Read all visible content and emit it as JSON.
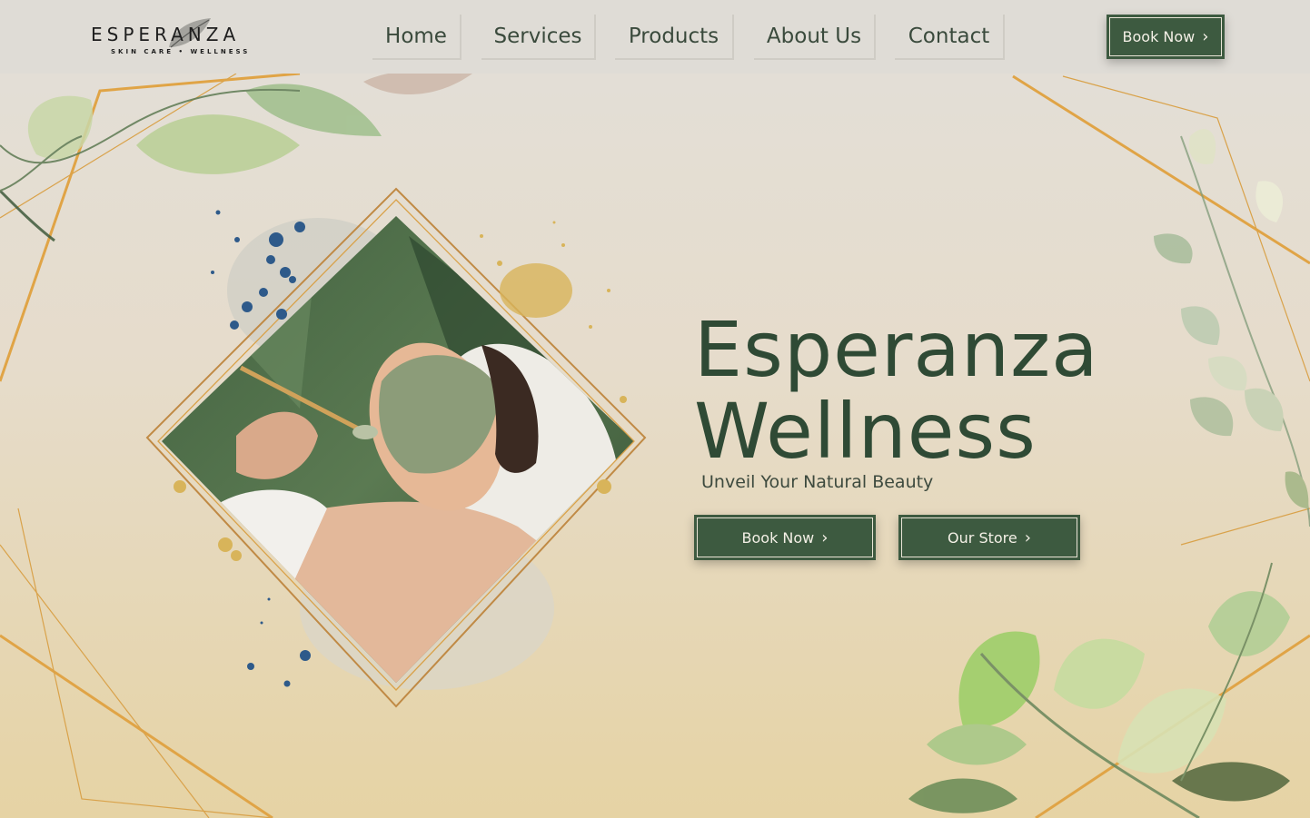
{
  "brand": {
    "name": "ESPERANZA",
    "tagline": "SKIN CARE • WELLNESS"
  },
  "nav": {
    "items": [
      {
        "label": "Home"
      },
      {
        "label": "Services"
      },
      {
        "label": "Products"
      },
      {
        "label": "About Us"
      },
      {
        "label": "Contact"
      }
    ],
    "cta_label": "Book Now"
  },
  "hero": {
    "title_line1": "Esperanza",
    "title_line2": "Wellness",
    "subtitle": "Unveil Your Natural Beauty",
    "primary_button": "Book Now",
    "secondary_button": "Our Store",
    "image_alt": "woman receiving green clay facial mask"
  },
  "icons": {
    "chevron": "chevron-right-icon",
    "leaf": "leaf-icon"
  },
  "colors": {
    "brand_green": "#3d5a40",
    "text_green": "#2f4a35",
    "gold": "#d9a24a",
    "ink_blue": "#2e5a8a"
  }
}
